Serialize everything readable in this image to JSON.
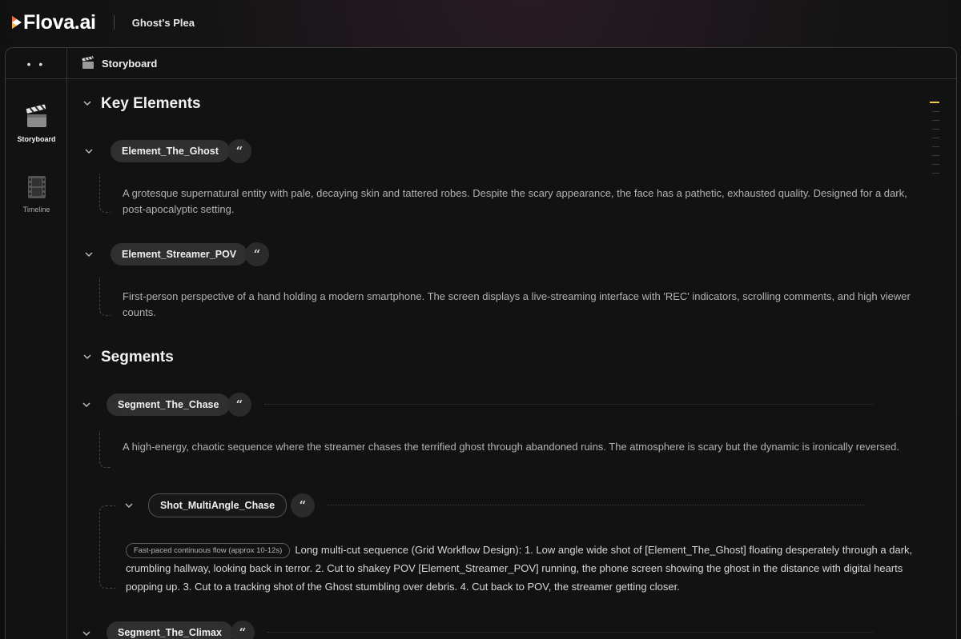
{
  "app": {
    "name": "Flova.ai",
    "project_title": "Ghost's Plea"
  },
  "header": {
    "dots_label": "• •",
    "title": "Storyboard"
  },
  "sidebar": {
    "items": [
      {
        "label": "Storyboard",
        "icon": "clapperboard-icon",
        "active": true
      },
      {
        "label": "Timeline",
        "icon": "film-strip-icon",
        "active": false
      }
    ]
  },
  "sections": {
    "key_elements": {
      "title": "Key Elements",
      "items": [
        {
          "name": "Element_The_Ghost",
          "quote": "“",
          "description": "A grotesque supernatural entity with pale, decaying skin and tattered robes. Despite the scary appearance, the face has a pathetic, exhausted quality. Designed for a dark, post-apocalyptic setting."
        },
        {
          "name": "Element_Streamer_POV",
          "quote": "“",
          "description": "First-person perspective of a hand holding a modern smartphone. The screen displays a live-streaming interface with 'REC' indicators, scrolling comments, and high viewer counts."
        }
      ]
    },
    "segments": {
      "title": "Segments",
      "items": [
        {
          "name": "Segment_The_Chase",
          "quote": "“",
          "description": "A high-energy, chaotic sequence where the streamer chases the terrified ghost through abandoned ruins. The atmosphere is scary but the dynamic is ironically reversed.",
          "shot": {
            "name": "Shot_MultiAngle_Chase",
            "quote": "“",
            "tag": "Fast-paced continuous flow (approx 10-12s)",
            "description": "Long multi-cut sequence (Grid Workflow Design): 1. Low angle wide shot of [Element_The_Ghost] floating desperately through a dark, crumbling hallway, looking back in terror. 2. Cut to shakey POV [Element_Streamer_POV] running, the phone screen showing the ghost in the distance with digital hearts popping up. 3. Cut to a tracking shot of the Ghost stumbling over debris. 4. Cut back to POV, the streamer getting closer."
          }
        },
        {
          "name": "Segment_The_Climax",
          "quote": "“"
        }
      ]
    }
  },
  "colors": {
    "accent": "#e9d24a",
    "pill_bg": "#2f2f2f",
    "background": "#121212"
  }
}
